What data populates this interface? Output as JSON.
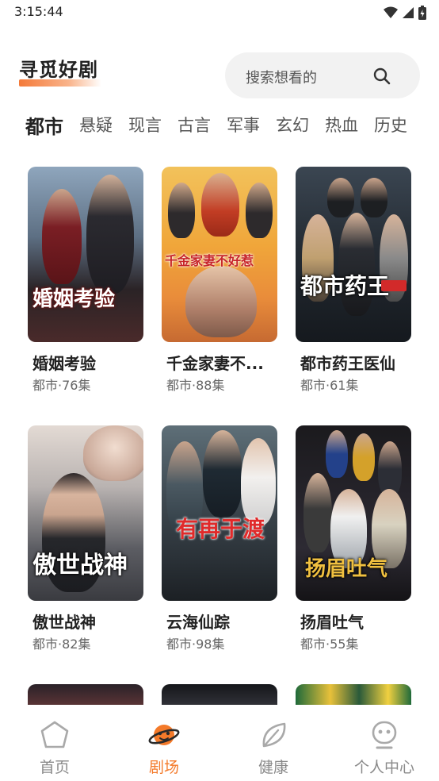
{
  "status_bar": {
    "time": "3:15:44"
  },
  "header": {
    "title": "寻觅好剧",
    "search_placeholder": "搜索想看的"
  },
  "tabs": [
    {
      "label": "都市",
      "active": true
    },
    {
      "label": "悬疑",
      "active": false
    },
    {
      "label": "现言",
      "active": false
    },
    {
      "label": "古言",
      "active": false
    },
    {
      "label": "军事",
      "active": false
    },
    {
      "label": "玄幻",
      "active": false
    },
    {
      "label": "热血",
      "active": false
    },
    {
      "label": "历史",
      "active": false
    }
  ],
  "dramas": [
    {
      "title": "婚姻考验",
      "meta": "都市·76集",
      "poster_text": "婚姻考验"
    },
    {
      "title": "千金家妻不...",
      "meta": "都市·88集",
      "poster_text": "千金家妻不好惹"
    },
    {
      "title": "都市药王医仙",
      "meta": "都市·61集",
      "poster_text": "都市药王"
    },
    {
      "title": "傲世战神",
      "meta": "都市·82集",
      "poster_text": "傲世战神"
    },
    {
      "title": "云海仙踪",
      "meta": "都市·98集",
      "poster_text": "有再于渡"
    },
    {
      "title": "扬眉吐气",
      "meta": "都市·55集",
      "poster_text": "扬眉吐气"
    }
  ],
  "bottom_nav": [
    {
      "label": "首页",
      "icon": "home-pentagon-icon",
      "active": false
    },
    {
      "label": "剧场",
      "icon": "theater-planet-icon",
      "active": true
    },
    {
      "label": "健康",
      "icon": "leaf-icon",
      "active": false
    },
    {
      "label": "个人中心",
      "icon": "robot-face-icon",
      "active": false
    }
  ],
  "colors": {
    "accent": "#f47a2a",
    "text": "#222222",
    "muted": "#666666",
    "search_bg": "#f2f2f2"
  }
}
